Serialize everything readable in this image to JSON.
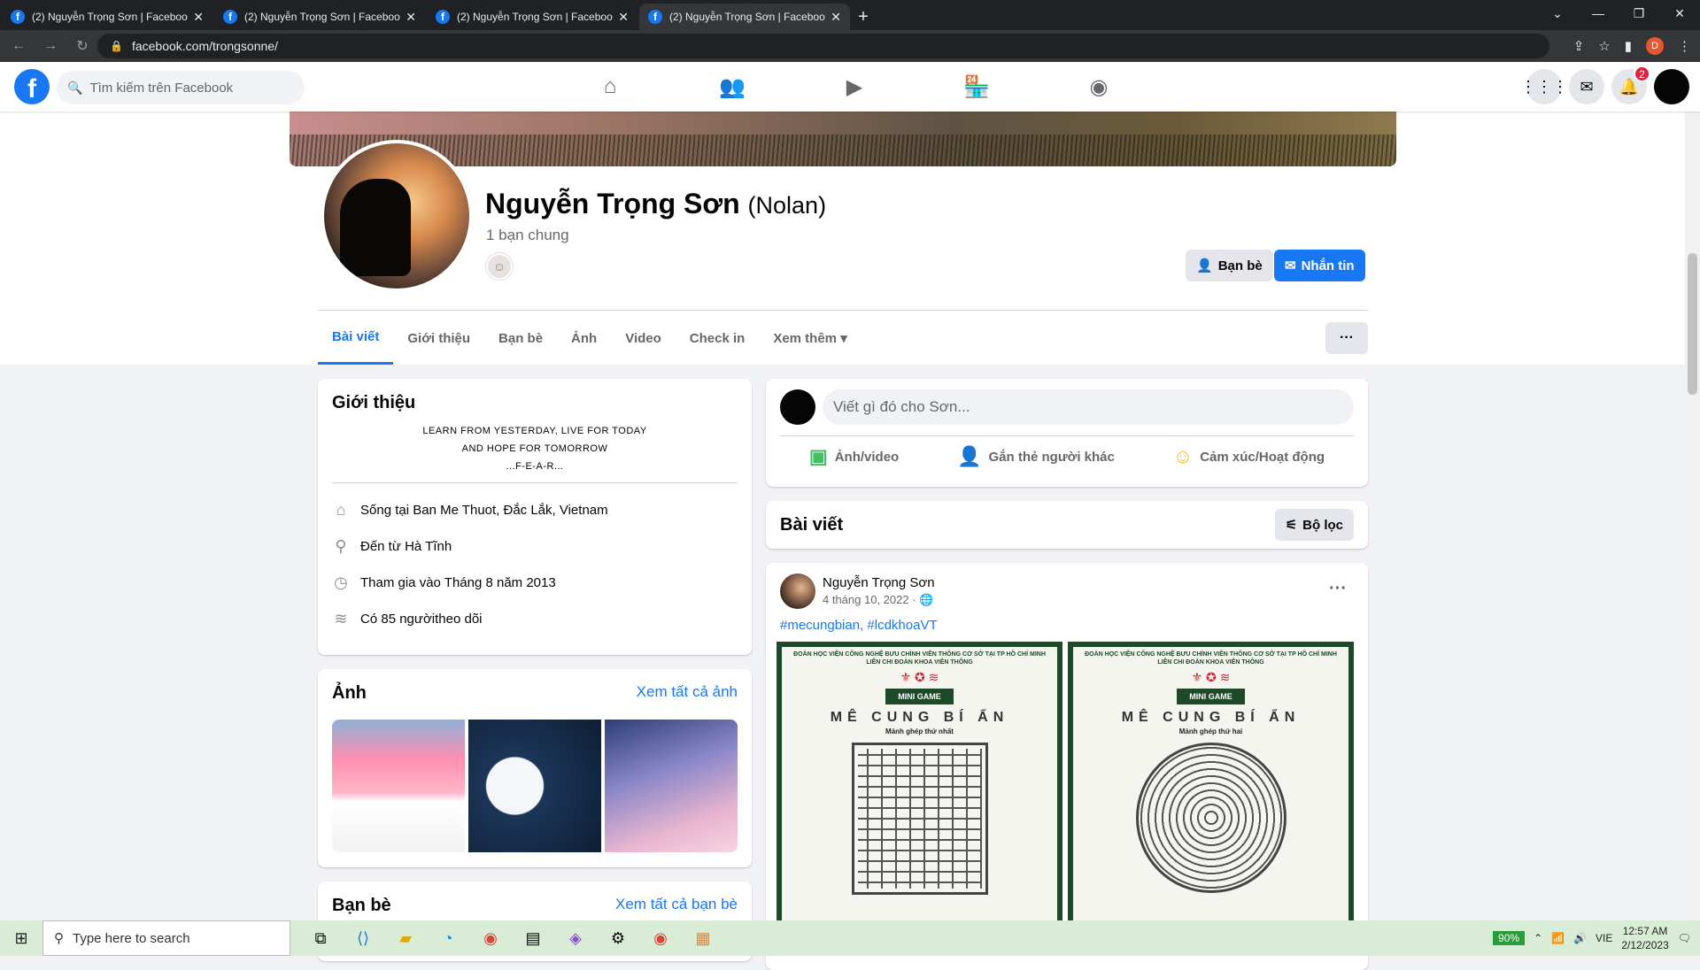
{
  "browser": {
    "tabs": [
      {
        "title": "(2) Nguyễn Trọng Sơn | Facebook",
        "active": false
      },
      {
        "title": "(2) Nguyễn Trọng Sơn | Facebook",
        "active": false
      },
      {
        "title": "(2) Nguyễn Trọng Sơn | Facebook",
        "active": false
      },
      {
        "title": "(2) Nguyễn Trọng Sơn | Facebook",
        "active": true
      }
    ],
    "url": "facebook.com/trongsonne/",
    "profile_letter": "D"
  },
  "fb_header": {
    "logo": "f",
    "search_placeholder": "Tìm kiếm trên Facebook",
    "notification_count": "2"
  },
  "profile": {
    "name": "Nguyễn Trọng Sơn",
    "alt_name": "(Nolan)",
    "mutual": "1 bạn chung",
    "friends_button": "Bạn bè",
    "message_button": "Nhắn tin",
    "tabs": [
      "Bài viết",
      "Giới thiệu",
      "Bạn bè",
      "Ảnh",
      "Video",
      "Check in",
      "Xem thêm"
    ],
    "more": "···"
  },
  "intro": {
    "title": "Giới thiệu",
    "bio_lines": [
      "LEARN FROM YESTERDAY, LIVE FOR TODAY",
      "AND HOPE FOR TOMORROW",
      "...F-E-A-R..."
    ],
    "lives_prefix": "Sống tại ",
    "lives": "Ban Me Thuot, Đắc Lắk, Vietnam",
    "from_prefix": "Đến từ ",
    "from": "Hà Tĩnh",
    "joined": "Tham gia vào Tháng 8 năm 2013",
    "followers_prefix": "Có ",
    "followers": "85 người",
    "followers_suffix": " theo dõi"
  },
  "photos": {
    "title": "Ảnh",
    "see_all": "Xem tất cả ảnh"
  },
  "friends": {
    "title": "Bạn bè",
    "see_all": "Xem tất cả bạn bè"
  },
  "composer": {
    "placeholder": "Viết gì đó cho Sơn...",
    "photo": "Ảnh/video",
    "tag": "Gắn thẻ người khác",
    "feeling": "Cảm xúc/Hoạt động"
  },
  "posts_bar": {
    "title": "Bài viết",
    "filter": "Bộ lọc"
  },
  "post": {
    "author": "Nguyễn Trọng Sơn",
    "date": "4 tháng 10, 2022 · 🌐",
    "hashtags": "#mecungbian, #lcdkhoaVT",
    "image_header": "ĐOÀN HỌC VIỆN CÔNG NGHỆ BƯU CHÍNH VIỄN THÔNG CƠ SỞ TẠI TP HỒ CHÍ MINH\nLIÊN CHI ĐOÀN KHOA VIỄN THÔNG",
    "mini_game": "MINI GAME",
    "maze_title": "MÊ CUNG BÍ ẨN",
    "piece1": "Mảnh ghép thứ nhất",
    "piece2": "Mảnh ghép thứ hai"
  },
  "taskbar": {
    "search": "Type here to search",
    "battery": "90%",
    "lang": "VIE",
    "time": "12:57 AM",
    "date": "2/12/2023"
  }
}
